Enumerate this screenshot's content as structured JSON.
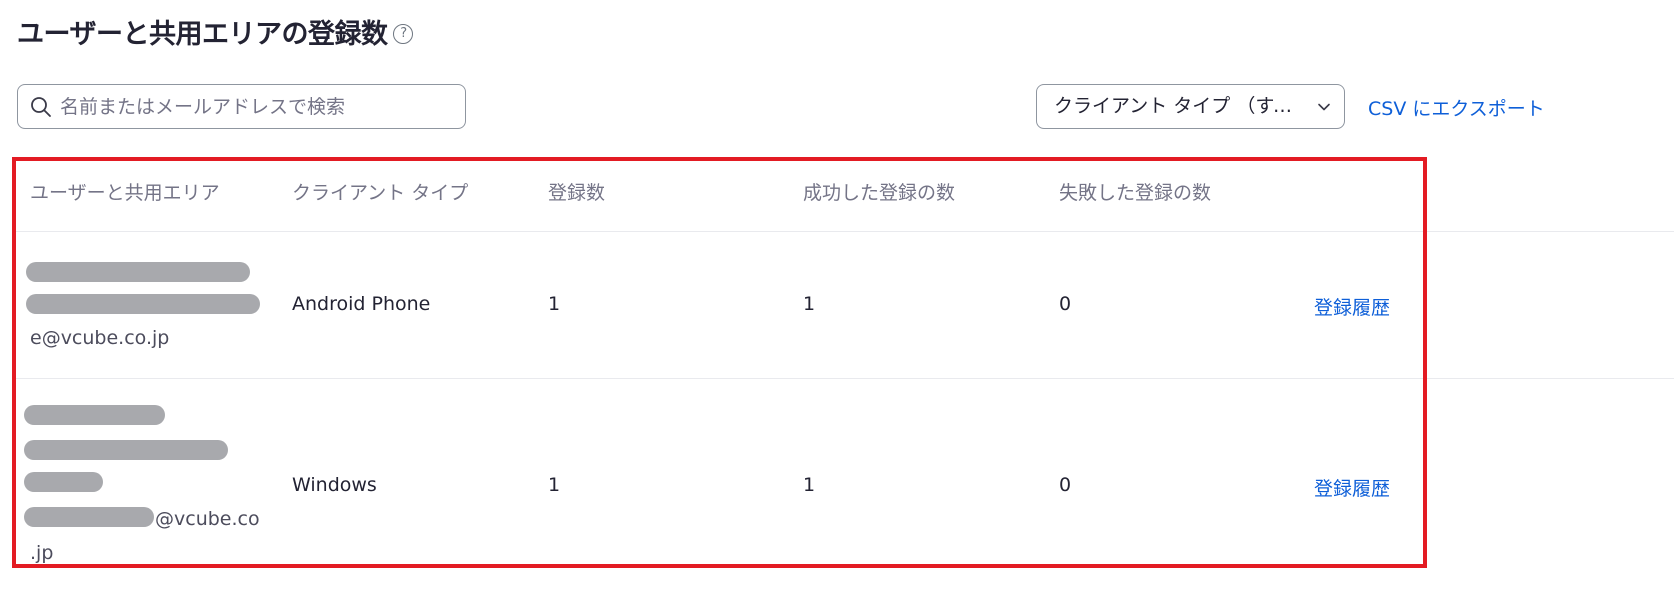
{
  "page": {
    "title": "ユーザーと共用エリアの登録数",
    "help_icon_glyph": "?"
  },
  "toolbar": {
    "search_placeholder": "名前またはメールアドレスで検索",
    "client_type_select_label": "クライアント タイプ （すべて）",
    "csv_export_label": "CSV にエクスポート"
  },
  "table": {
    "columns": [
      "ユーザーと共用エリア",
      "クライアント タイプ",
      "登録数",
      "成功した登録の数",
      "失敗した登録の数"
    ],
    "rows": [
      {
        "user_visible_text": [
          "e@vcube.co.jp"
        ],
        "client_type": "Android Phone",
        "registrations": "1",
        "successful": "1",
        "failed": "0",
        "history_link": "登録履歴"
      },
      {
        "user_visible_text": [
          "@vcube.co",
          ".jp"
        ],
        "client_type": "Windows",
        "registrations": "1",
        "successful": "1",
        "failed": "0",
        "history_link": "登録履歴"
      }
    ]
  },
  "colors": {
    "link": "#0e5fd8",
    "highlight_border": "#e31b23",
    "redaction": "#a8a9ad"
  },
  "icons": {
    "search": "search-icon",
    "chevron": "chevron-down-icon",
    "help": "help-icon"
  }
}
